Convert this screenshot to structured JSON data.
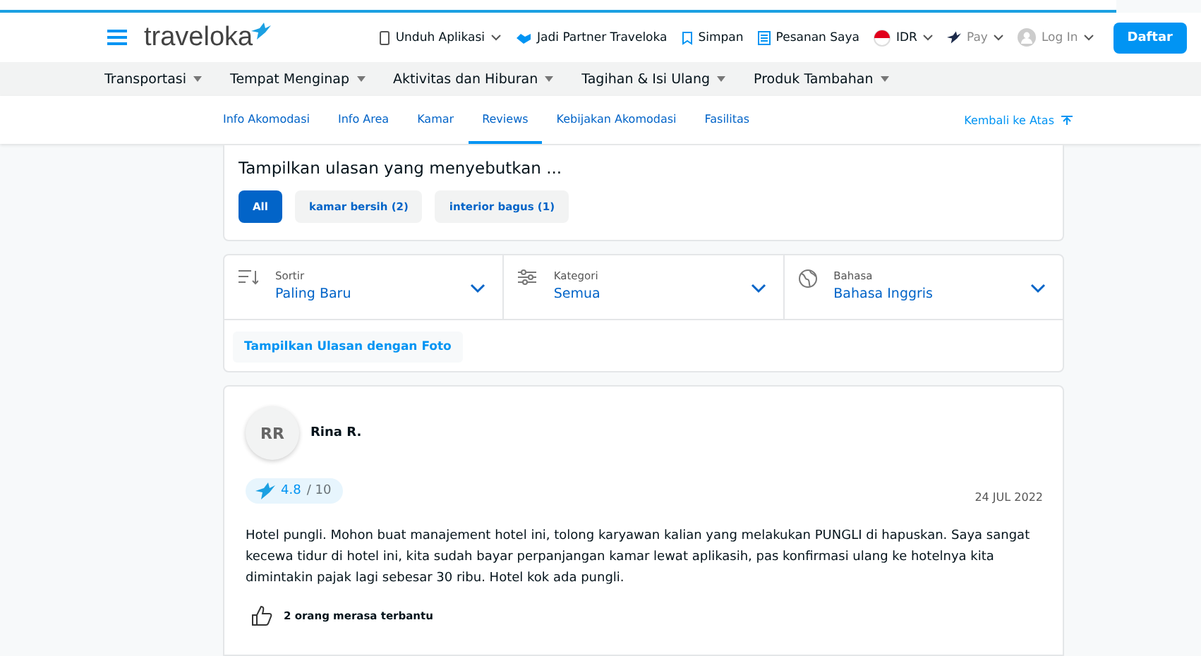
{
  "header": {
    "logo": "traveloka",
    "links": [
      {
        "kind": "phone",
        "label": "Unduh Aplikasi",
        "caret": true
      },
      {
        "kind": "partner",
        "label": "Jadi Partner Traveloka",
        "caret": false
      },
      {
        "kind": "bookmark",
        "label": "Simpan",
        "caret": false
      },
      {
        "kind": "list",
        "label": "Pesanan Saya",
        "caret": false
      },
      {
        "kind": "flag",
        "label": "IDR",
        "caret": true
      },
      {
        "kind": "pay",
        "label": "Pay",
        "caret": true
      },
      {
        "kind": "user",
        "label": "Log In",
        "caret": true
      }
    ],
    "signup": "Daftar"
  },
  "nav": [
    "Transportasi",
    "Tempat Menginap",
    "Aktivitas dan Hiburan",
    "Tagihan & Isi Ulang",
    "Produk Tambahan"
  ],
  "subnav": {
    "tabs": [
      {
        "label": "Info Akomodasi",
        "selected": false
      },
      {
        "label": "Info Area",
        "selected": false
      },
      {
        "label": "Kamar",
        "selected": false
      },
      {
        "label": "Reviews",
        "selected": true
      },
      {
        "label": "Kebijakan Akomodasi",
        "selected": false
      },
      {
        "label": "Fasilitas",
        "selected": false
      }
    ],
    "back_to_top": "Kembali ke Atas"
  },
  "mentions": {
    "title": "Tampilkan ulasan yang menyebutkan ...",
    "chips": [
      {
        "label": "All",
        "selected": true
      },
      {
        "label": "kamar bersih (2)",
        "selected": false
      },
      {
        "label": "interior bagus (1)",
        "selected": false
      }
    ]
  },
  "filters": [
    {
      "kind": "sort",
      "label": "Sortir",
      "value": "Paling Baru"
    },
    {
      "kind": "category",
      "label": "Kategori",
      "value": "Semua"
    },
    {
      "kind": "language",
      "label": "Bahasa",
      "value": "Bahasa Inggris"
    }
  ],
  "photo_button": "Tampilkan Ulasan dengan Foto",
  "review": {
    "initials": "RR",
    "name": "Rina R.",
    "score": "4.8",
    "max": "/ 10",
    "date": "24 JUL 2022",
    "text": "Hotel pungli. Mohon buat manajement hotel ini, tolong karyawan kalian yang melakukan PUNGLI di hapuskan. Saya sangat kecewa tidur di hotel ini, kita sudah bayar perpanjangan kamar lewat aplikasih, pas konfirmasi ulang ke hotelnya kita dimintakin pajak lagi sebesar 30 ribu. Hotel kok ada pungli.",
    "helpful": "2 orang merasa terbantu"
  }
}
